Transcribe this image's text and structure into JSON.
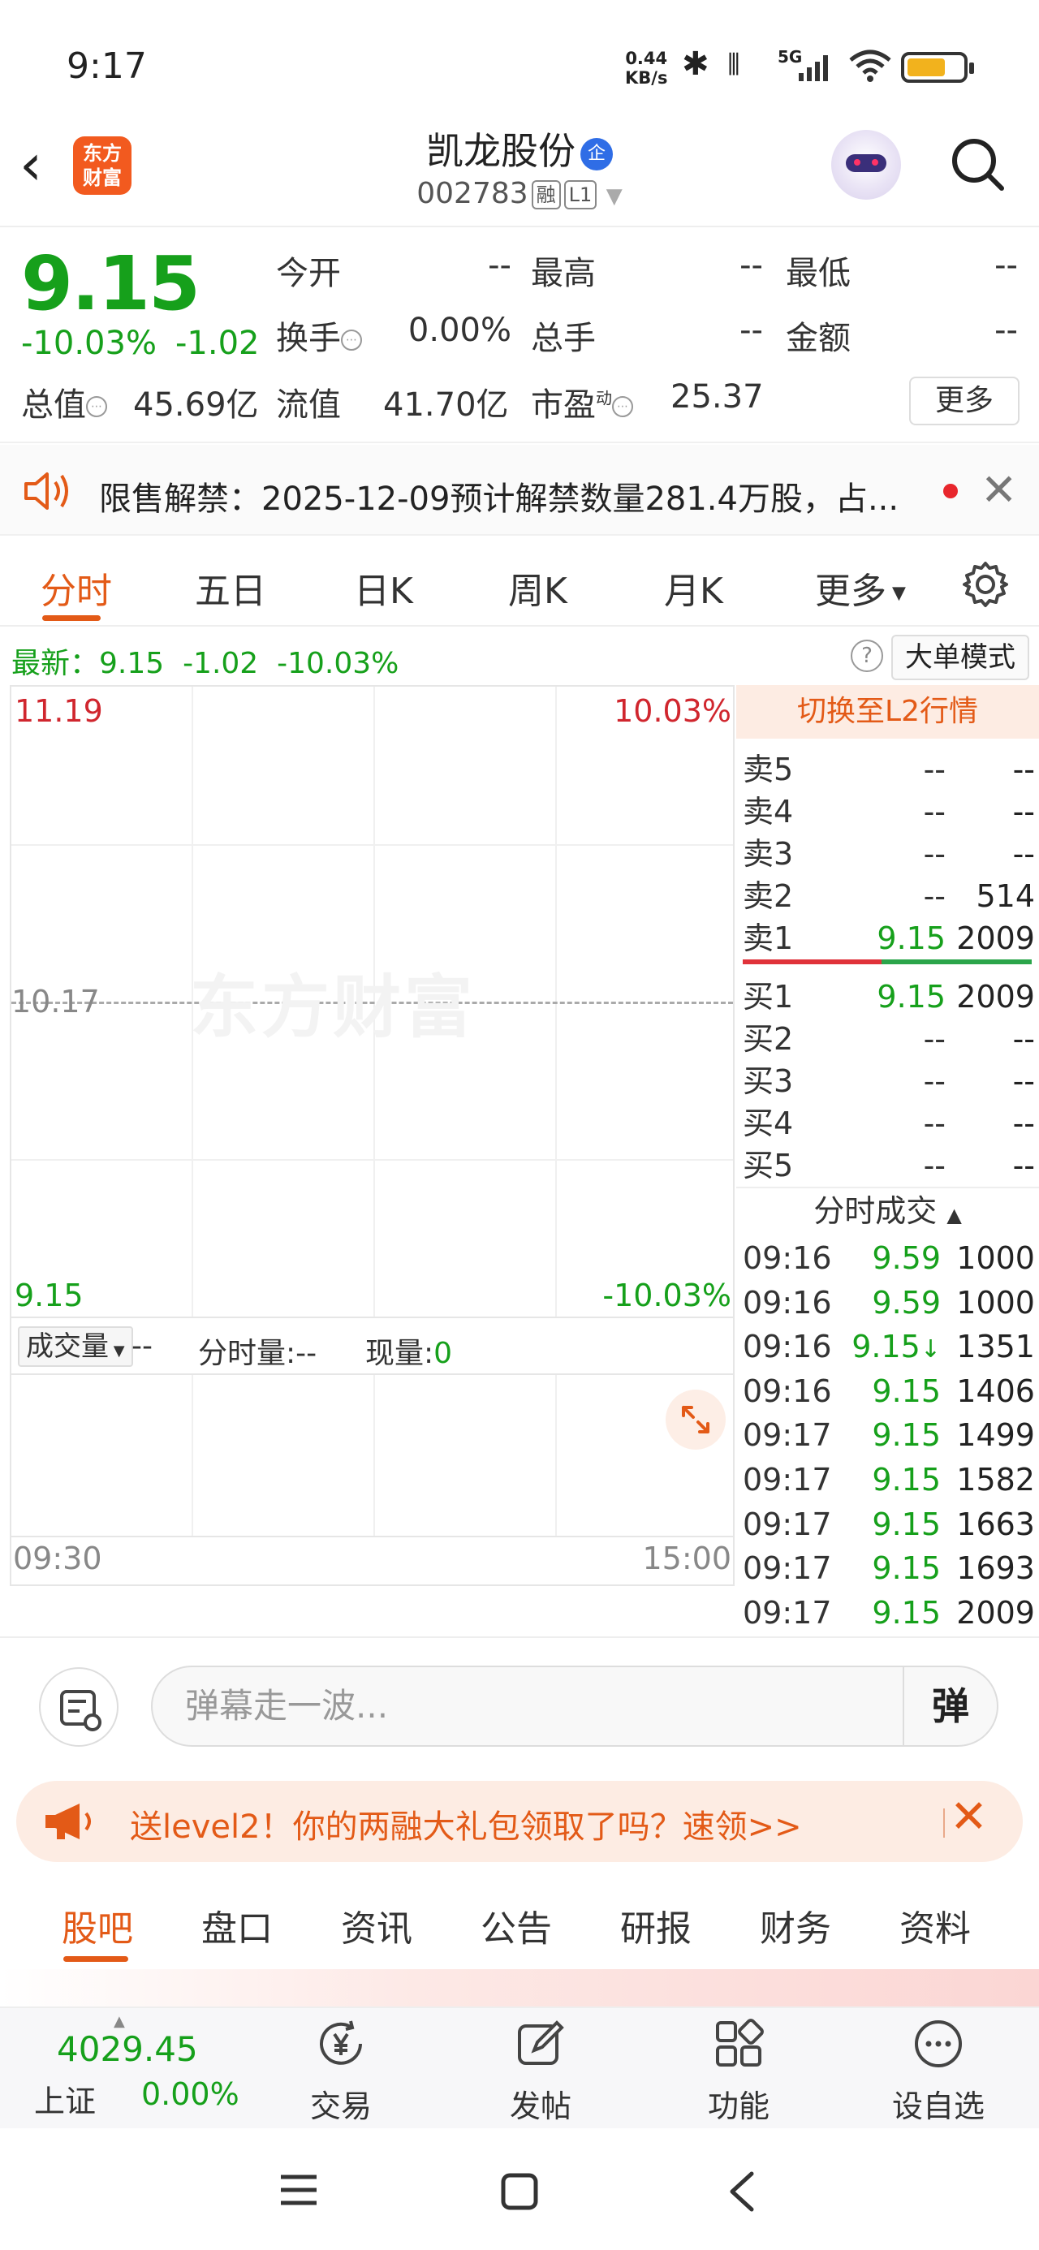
{
  "status_bar": {
    "time": "9:17",
    "net_speed_value": "0.44",
    "net_speed_unit": "KB/s",
    "signal_label": "5G",
    "battery_level": 0.7,
    "colors": {
      "battery": "#f2b21d"
    }
  },
  "header": {
    "logo_line1": "东方",
    "logo_line2": "财富",
    "stock_name": "凯龙股份",
    "badge": "企",
    "stock_code": "002783",
    "tag_margin": "融",
    "tag_level": "L1"
  },
  "quote": {
    "price": "9.15",
    "change_pct": "-10.03%",
    "change": "-1.02",
    "open_label": "今开",
    "open": "--",
    "high_label": "最高",
    "high": "--",
    "low_label": "最低",
    "low": "--",
    "turnover_label": "换手",
    "turnover": "0.00%",
    "volume_label": "总手",
    "volume": "--",
    "amount_label": "金额",
    "amount": "--",
    "mktcap_label": "总值",
    "mktcap": "45.69亿",
    "float_label": "流值",
    "float": "41.70亿",
    "pe_label": "市盈",
    "pe_sup": "动",
    "pe": "25.37",
    "more": "更多"
  },
  "notice": {
    "text": "限售解禁：2025-12-09预计解禁数量281.4万股，占..."
  },
  "chart_tabs": [
    "分时",
    "五日",
    "日K",
    "周K",
    "月K",
    "更多"
  ],
  "latest": {
    "label": "最新：",
    "price": "9.15",
    "change": "-1.02",
    "pct": "-10.03%",
    "help": "?",
    "big_order_mode": "大单模式"
  },
  "chart_data": {
    "type": "line",
    "title": "",
    "y_max": "11.19",
    "y_max_pct": "10.03%",
    "y_mid": "10.17",
    "y_min": "9.15",
    "y_min_pct": "-10.03%",
    "x_start": "09:30",
    "x_end": "15:00",
    "watermark": "东方财富",
    "ylim": [
      9.15,
      11.19
    ],
    "series": [
      {
        "values": []
      }
    ]
  },
  "volume_panel": {
    "selector": "成交量",
    "selector_value": "--",
    "period_label": "分时量:",
    "period_value": "--",
    "now_label": "现量:",
    "now_value": "0"
  },
  "order_book": {
    "switch_l2": "切换至L2行情",
    "asks": [
      {
        "name": "卖5",
        "price": "--",
        "vol": "--"
      },
      {
        "name": "卖4",
        "price": "--",
        "vol": "--"
      },
      {
        "name": "卖3",
        "price": "--",
        "vol": "--"
      },
      {
        "name": "卖2",
        "price": "--",
        "vol": "514"
      },
      {
        "name": "卖1",
        "price": "9.15",
        "vol": "2009"
      }
    ],
    "bids": [
      {
        "name": "买1",
        "price": "9.15",
        "vol": "2009"
      },
      {
        "name": "买2",
        "price": "--",
        "vol": "--"
      },
      {
        "name": "买3",
        "price": "--",
        "vol": "--"
      },
      {
        "name": "买4",
        "price": "--",
        "vol": "--"
      },
      {
        "name": "买5",
        "price": "--",
        "vol": "--"
      }
    ],
    "trades_header": "分时成交",
    "trades": [
      {
        "time": "09:16",
        "price": "9.59",
        "vol": "1000",
        "color": "green",
        "arrow": ""
      },
      {
        "time": "09:16",
        "price": "9.59",
        "vol": "1000",
        "color": "green",
        "arrow": ""
      },
      {
        "time": "09:16",
        "price": "9.15",
        "vol": "1351",
        "color": "green",
        "arrow": "↓"
      },
      {
        "time": "09:16",
        "price": "9.15",
        "vol": "1406",
        "color": "green",
        "arrow": ""
      },
      {
        "time": "09:17",
        "price": "9.15",
        "vol": "1499",
        "color": "green",
        "arrow": ""
      },
      {
        "time": "09:17",
        "price": "9.15",
        "vol": "1582",
        "color": "green",
        "arrow": ""
      },
      {
        "time": "09:17",
        "price": "9.15",
        "vol": "1663",
        "color": "green",
        "arrow": ""
      },
      {
        "time": "09:17",
        "price": "9.15",
        "vol": "1693",
        "color": "green",
        "arrow": ""
      },
      {
        "time": "09:17",
        "price": "9.15",
        "vol": "2009",
        "color": "green",
        "arrow": ""
      }
    ]
  },
  "comment": {
    "placeholder": "弹幕走一波...",
    "danmu_btn": "弹"
  },
  "promo": {
    "text": "送level2！你的两融大礼包领取了吗？速领>>"
  },
  "section_tabs": [
    "股吧",
    "盘口",
    "资讯",
    "公告",
    "研报",
    "财务",
    "资料"
  ],
  "bottom_nav": {
    "index_value": "4029.45",
    "index_name": "上证",
    "index_change": "0.00%",
    "items": [
      "交易",
      "发帖",
      "功能",
      "设自选"
    ]
  },
  "colors": {
    "up": "#d0262e",
    "down": "#16a01b",
    "accent": "#e35a17"
  }
}
